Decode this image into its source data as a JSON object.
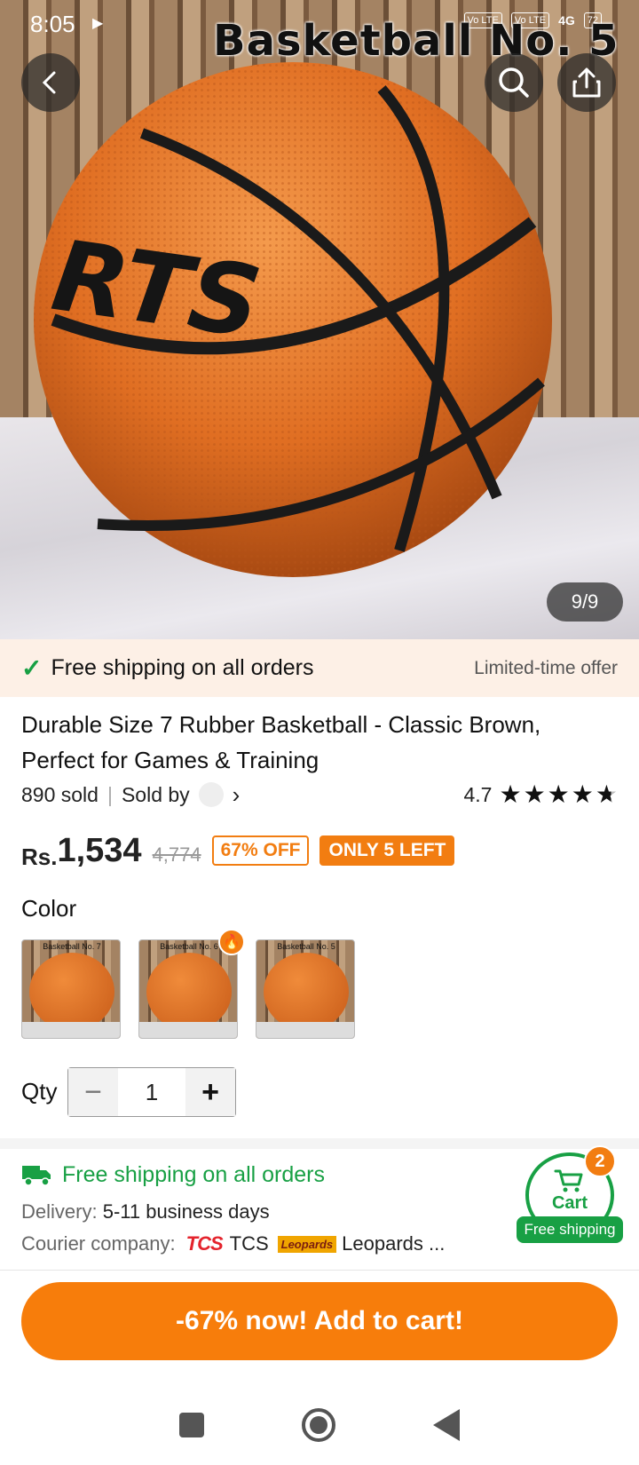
{
  "status_bar": {
    "time": "8:05",
    "network": "4G",
    "battery": "72",
    "volte1": "Vo LTE",
    "volte2": "Vo LTE"
  },
  "hero": {
    "image_title": "Basketball No. 5",
    "ball_text": "RTS",
    "counter": "9/9"
  },
  "banner": {
    "text": "Free shipping on all orders",
    "offer": "Limited-time offer"
  },
  "product": {
    "title": "Durable Size 7 Rubber Basketball - Classic Brown, Perfect for Games & Training",
    "sold": "890 sold",
    "sold_by": "Sold by",
    "rating": "4.7"
  },
  "price": {
    "currency": "Rs.",
    "value": "1,534",
    "original": "4,774",
    "discount": "67% OFF",
    "stock": "ONLY 5 LEFT"
  },
  "color": {
    "label": "Color",
    "options": [
      {
        "label": "Basketball No. 7"
      },
      {
        "label": "Basketball No. 6"
      },
      {
        "label": "Basketball No. 5"
      }
    ]
  },
  "qty": {
    "label": "Qty",
    "value": "1",
    "minus": "−",
    "plus": "+"
  },
  "shipping": {
    "title": "Free shipping on all orders",
    "delivery_key": "Delivery:",
    "delivery_val": "5-11 business days",
    "courier_key": "Courier company:",
    "courier_tcs_logo": "TCS",
    "courier_tcs": "TCS",
    "courier_leo_logo": "Leopards",
    "courier_leo": "Leopards ..."
  },
  "cart": {
    "label": "Cart",
    "count": "2",
    "shipping": "Free shipping"
  },
  "cta": {
    "label": "-67% now! Add to cart!"
  },
  "colors": {
    "accent": "#f77d0b",
    "green": "#18a044",
    "banner_bg": "#fdf0e6"
  }
}
